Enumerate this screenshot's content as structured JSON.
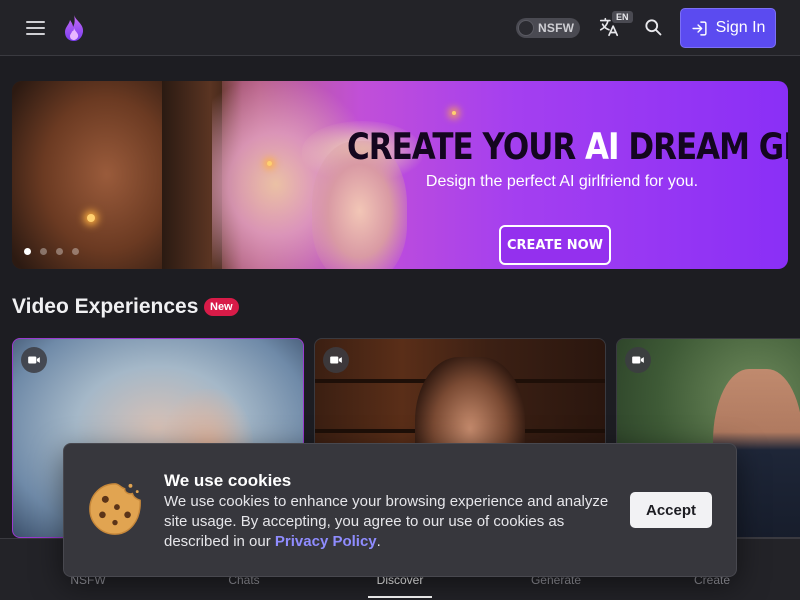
{
  "header": {
    "menu_icon": "hamburger-menu-icon",
    "logo_icon": "flame-logo-icon",
    "nsfw_label": "NSFW",
    "nsfw_enabled": false,
    "language_icon": "translate-icon",
    "language_badge": "EN",
    "search_icon": "search-icon",
    "signin_icon": "sign-in-icon",
    "signin_label": "Sign In",
    "accent_color": "#5b4bf0"
  },
  "banner": {
    "headline_part1": "CREATE YOUR ",
    "headline_ai": "AI",
    "headline_part2": " DREAM GIRL",
    "subtitle": "Design the perfect AI girlfriend for you.",
    "cta_label": "CREATE NOW",
    "slide_count": 4,
    "active_slide": 1
  },
  "section": {
    "title": "Video Experiences",
    "badge": "New",
    "badge_color": "#d81b48",
    "cards": [
      {
        "icon": "video-camera-icon"
      },
      {
        "icon": "video-camera-icon"
      },
      {
        "icon": "video-camera-icon"
      }
    ]
  },
  "bottom_nav": {
    "items": [
      {
        "label": "NSFW"
      },
      {
        "label": "Chats"
      },
      {
        "label": "Discover",
        "active": true
      },
      {
        "label": "Generate"
      },
      {
        "label": "Create"
      }
    ]
  },
  "cookie": {
    "icon": "cookie-icon",
    "title": "We use cookies",
    "body_text": "We use cookies to enhance your browsing experience and analyze site usage. By accepting, you agree to our use of cookies as described in our ",
    "policy_link": "Privacy Policy",
    "body_end": ".",
    "accept_label": "Accept"
  }
}
